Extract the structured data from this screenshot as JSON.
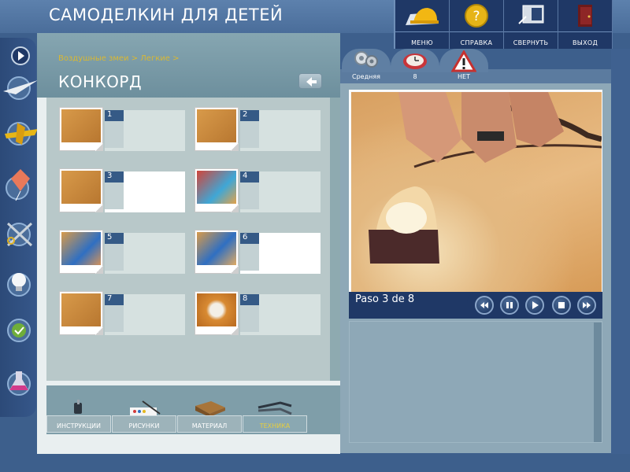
{
  "app_title": "САМОДЕЛКИН ДЛЯ ДЕТЕЙ",
  "menu": [
    {
      "label": "МЕНЮ",
      "icon": "helmet-icon"
    },
    {
      "label": "СПРАВКА",
      "icon": "help-icon"
    },
    {
      "label": "СВЕРНУТЬ",
      "icon": "minimize-icon"
    },
    {
      "label": "ВЫХОД",
      "icon": "exit-door-icon"
    }
  ],
  "breadcrumb": "Воздушные змеи > Легкие >",
  "page_title": "КОНКОРД",
  "steps": [
    {
      "num": "1",
      "active": false
    },
    {
      "num": "2",
      "active": false
    },
    {
      "num": "3",
      "active": true
    },
    {
      "num": "4",
      "active": false
    },
    {
      "num": "5",
      "active": false
    },
    {
      "num": "6",
      "active": true
    },
    {
      "num": "7",
      "active": false
    },
    {
      "num": "8",
      "active": false
    }
  ],
  "bottom_tabs": [
    {
      "label": "ИНСТРУКЦИИ",
      "active": false,
      "icon": "screwdriver-icon"
    },
    {
      "label": "РИСУНКИ",
      "active": false,
      "icon": "paint-palette-icon"
    },
    {
      "label": "МАТЕРИАЛ",
      "active": false,
      "icon": "toolbox-icon"
    },
    {
      "label": "ТЕХНИКА",
      "active": true,
      "icon": "pliers-icon"
    }
  ],
  "info_tabs": [
    {
      "label": "Средняя",
      "icon": "gears-icon"
    },
    {
      "label": "8",
      "icon": "clock-icon"
    },
    {
      "label": "НЕТ",
      "icon": "warning-icon"
    }
  ],
  "video": {
    "step_counter": "Paso 3 de 8"
  },
  "colors": {
    "header_blue": "#4a6d9a",
    "menu_navy": "#1f3866",
    "accent_yellow": "#d9b833",
    "panel_teal": "#7f9ea9"
  }
}
